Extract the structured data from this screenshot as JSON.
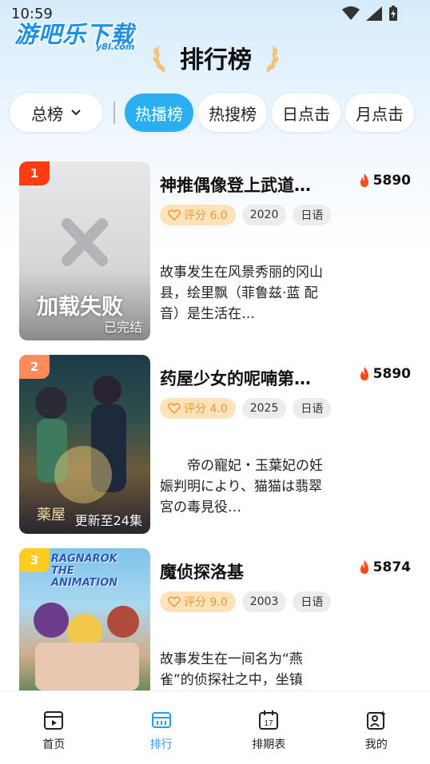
{
  "status_bar": {
    "time": "10:59"
  },
  "logo": {
    "main": "游吧乐下载",
    "sub": "y8l.com"
  },
  "header": {
    "title": "排行榜"
  },
  "filters": {
    "total_label": "总榜",
    "tabs": [
      {
        "label": "热播榜",
        "active": true
      },
      {
        "label": "热搜榜",
        "active": false
      },
      {
        "label": "日点击",
        "active": false
      },
      {
        "label": "月点击",
        "active": false
      }
    ]
  },
  "items": [
    {
      "rank": "1",
      "rank_color": "#ff3b10",
      "title": "神推偶像登上武道…",
      "heat": "5890",
      "score": "评分 6.0",
      "year": "2020",
      "lang": "日语",
      "poster_status": "已完结",
      "poster_text": "加载失败",
      "desc": "故事发生在风景秀丽的冈山县，绘里飘（菲鲁兹·蓝 配音）是生活在…"
    },
    {
      "rank": "2",
      "rank_color": "#ff8a5c",
      "title": "药屋少女的呢喃第…",
      "heat": "5890",
      "score": "评分 4.0",
      "year": "2025",
      "lang": "日语",
      "poster_status": "更新至24集",
      "poster_text": "薬屋",
      "desc": "　　帝の寵妃・玉葉妃の妊娠判明により、猫猫は翡翠宮の毒見役…"
    },
    {
      "rank": "3",
      "rank_color": "#ffcc22",
      "title": "魔侦探洛基",
      "heat": "5874",
      "score": "评分 9.0",
      "year": "2003",
      "lang": "日语",
      "poster_status": "",
      "poster_text": "RAGNAROK THE ANIMATION",
      "desc": "故事发生在一间名为“燕雀”的侦探社之中，坐镇"
    }
  ],
  "tabbar": [
    {
      "label": "首页",
      "icon": "home-icon",
      "active": false
    },
    {
      "label": "排行",
      "icon": "ranking-icon",
      "active": true
    },
    {
      "label": "排期表",
      "icon": "calendar-icon",
      "active": false
    },
    {
      "label": "我的",
      "icon": "profile-icon",
      "active": false
    }
  ],
  "colors": {
    "accent": "#2ab0f0",
    "heat": "#ff4a1a",
    "score_bg": "#ffe2b8"
  }
}
